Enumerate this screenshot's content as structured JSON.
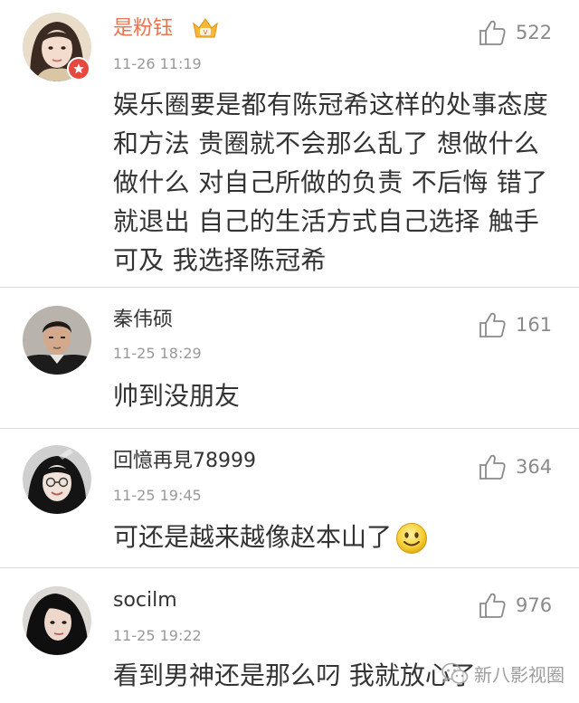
{
  "comments": [
    {
      "username": "是粉钰",
      "time": "11-26 11:19",
      "likes": "522",
      "text": "娱乐圈要是都有陈冠希这样的处事态度和方法 贵圈就不会那么乱了 想做什么做什么 对自己所做的负责 不后悔 错了就退出 自己的生活方式自己选择 触手可及 我选择陈冠希",
      "username_color": "#eb7350",
      "badges": [
        "vip-crown-icon",
        "verified-badge-icon"
      ]
    },
    {
      "username": "秦伟硕",
      "time": "11-25 18:29",
      "likes": "161",
      "text": "帅到没朋友"
    },
    {
      "username": "回憶再見78999",
      "time": "11-25 19:45",
      "likes": "364",
      "text": "可还是越来越像赵本山了",
      "emoji": "smile-emoji-icon"
    },
    {
      "username": "socilm",
      "time": "11-25 19:22",
      "likes": "976",
      "text": "看到男神还是那么叼 我就放心了"
    }
  ],
  "watermark": {
    "text": "新八影视圈",
    "icon": "wechat-icon"
  },
  "colors": {
    "vip_name": "#eb7350",
    "secondary_text": "#999999",
    "divider": "#dcdcdc",
    "verified_badge": "#e8493e"
  }
}
